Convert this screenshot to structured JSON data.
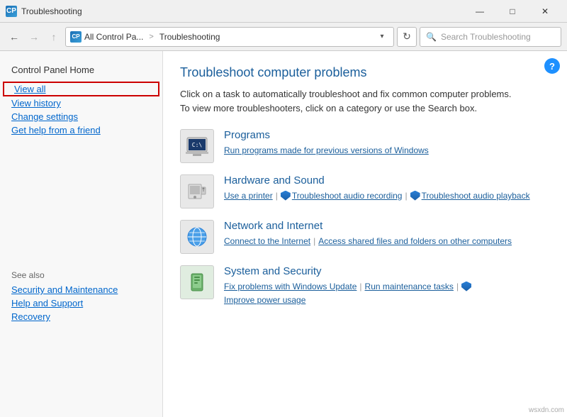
{
  "titlebar": {
    "icon_label": "CP",
    "title": "Troubleshooting",
    "minimize_label": "—",
    "maximize_label": "□",
    "close_label": "✕"
  },
  "addressbar": {
    "back_label": "←",
    "forward_label": "→",
    "up_label": "↑",
    "path_icon": "CP",
    "path_short": "All Control Pa...",
    "separator": ">",
    "current": "Troubleshooting",
    "dropdown_label": "▾",
    "refresh_label": "↻",
    "search_icon": "🔍",
    "search_placeholder": "Search Troubleshooting"
  },
  "sidebar": {
    "home_label": "Control Panel Home",
    "links": [
      {
        "id": "view-all",
        "label": "View all",
        "highlighted": true
      },
      {
        "id": "view-history",
        "label": "View history"
      },
      {
        "id": "change-settings",
        "label": "Change settings"
      },
      {
        "id": "get-help",
        "label": "Get help from a friend"
      }
    ],
    "see_also_label": "See also",
    "see_also_links": [
      {
        "id": "security",
        "label": "Security and Maintenance"
      },
      {
        "id": "help",
        "label": "Help and Support"
      },
      {
        "id": "recovery",
        "label": "Recovery"
      }
    ]
  },
  "main": {
    "help_label": "?",
    "title": "Troubleshoot computer problems",
    "description": "Click on a task to automatically troubleshoot and fix common computer problems. To view more troubleshooters, click on a category or use the Search box.",
    "categories": [
      {
        "id": "programs",
        "icon": "🖥",
        "title": "Programs",
        "subtitle": "Run programs made for previous versions of Windows",
        "links": []
      },
      {
        "id": "hardware",
        "icon": "🖨",
        "title": "Hardware and Sound",
        "subtitle": "",
        "links": [
          {
            "label": "Use a printer",
            "shield": false
          },
          {
            "label": "Troubleshoot audio recording",
            "shield": true
          },
          {
            "label": "Troubleshoot audio playback",
            "shield": true
          }
        ]
      },
      {
        "id": "network",
        "icon": "🌐",
        "title": "Network and Internet",
        "subtitle": "",
        "links": [
          {
            "label": "Connect to the Internet",
            "shield": false
          },
          {
            "label": "Access shared files and folders on other computers",
            "shield": false
          }
        ]
      },
      {
        "id": "system",
        "icon": "🛡",
        "title": "System and Security",
        "subtitle": "",
        "links": [
          {
            "label": "Fix problems with Windows Update",
            "shield": false
          },
          {
            "label": "Run maintenance tasks",
            "shield": false
          },
          {
            "label": "Improve power usage",
            "shield": true
          }
        ]
      }
    ]
  },
  "watermark": "wsxdn.com"
}
